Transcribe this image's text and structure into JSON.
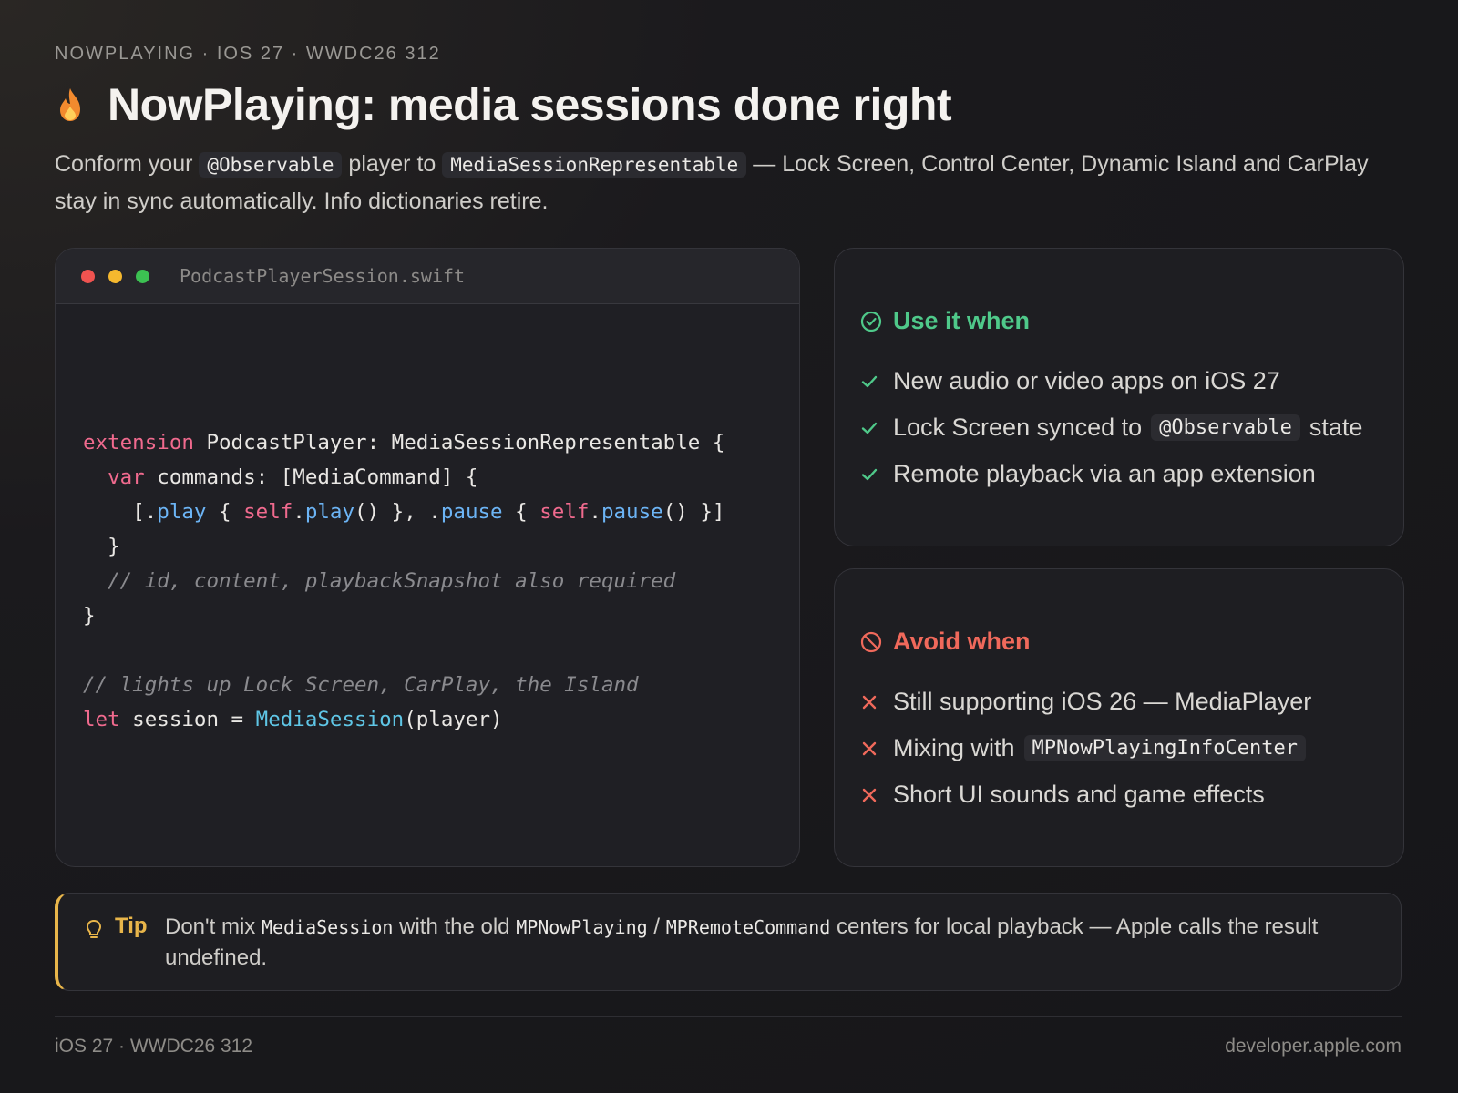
{
  "header": {
    "eyebrow": "NOWPLAYING · IOS 27 · WWDC26 312",
    "title": "NowPlaying: media sessions done right",
    "title_icon": "flame-icon",
    "subtitle": {
      "part1": "Conform your ",
      "chip1": "@Observable",
      "part2": " player to ",
      "chip2": "MediaSessionRepresentable",
      "part3": " — Lock Screen, Control Center, Dynamic Island and CarPlay stay in sync automatically. Info dictionaries retire."
    }
  },
  "code_card": {
    "filename": "PodcastPlayerSession.swift",
    "window_dots": [
      "#ef5350",
      "#f5b82e",
      "#3cc152"
    ],
    "code": {
      "l1_kw": "extension",
      "l1_rest": " PodcastPlayer: MediaSessionRepresentable {",
      "l2_kw": "var",
      "l2_rest": " commands: [MediaCommand] {",
      "l3_a": "[.",
      "l3_play": "play",
      "l3_b": " { ",
      "l3_self1": "self",
      "l3_c": ".",
      "l3_play2": "play",
      "l3_d": "() }, .",
      "l3_pause": "pause",
      "l3_e": " { ",
      "l3_self2": "self",
      "l3_f": ".",
      "l3_pause2": "pause",
      "l3_g": "() }]",
      "l4": "}",
      "l5_comment": "// id, content, playbackSnapshot also required",
      "l6": "}",
      "l8_comment": "// lights up Lock Screen, CarPlay, the Island",
      "l9_kw": "let",
      "l9_a": " session = ",
      "l9_type": "MediaSession",
      "l9_b": "(player)"
    }
  },
  "use_panel": {
    "title": "Use it when",
    "icon": "check-circle-icon",
    "color": "#4fc98a",
    "items": [
      {
        "text": "New audio or video apps on iOS 27"
      },
      {
        "before": "Lock Screen synced to",
        "chip": "@Observable",
        "after": "state"
      },
      {
        "text": "Remote playback via an app extension"
      }
    ]
  },
  "avoid_panel": {
    "title": "Avoid when",
    "icon": "prohibited-icon",
    "color": "#f0695b",
    "items": [
      {
        "text": "Still supporting iOS 26 — MediaPlayer"
      },
      {
        "before": "Mixing with",
        "chip": "MPNowPlayingInfoCenter"
      },
      {
        "text": "Short UI sounds and game effects"
      }
    ]
  },
  "tip": {
    "label": "Tip",
    "icon": "lightbulb-icon",
    "color": "#e8b54a",
    "t1": "Don't mix ",
    "c1": "MediaSession",
    "t2": " with the old ",
    "c2": "MPNowPlaying",
    "t3": " / ",
    "c3": "MPRemoteCommand",
    "t4": " centers for local playback — Apple calls the result undefined."
  },
  "footer": {
    "left": "iOS 27 · WWDC26 312",
    "right": "developer.apple.com"
  }
}
